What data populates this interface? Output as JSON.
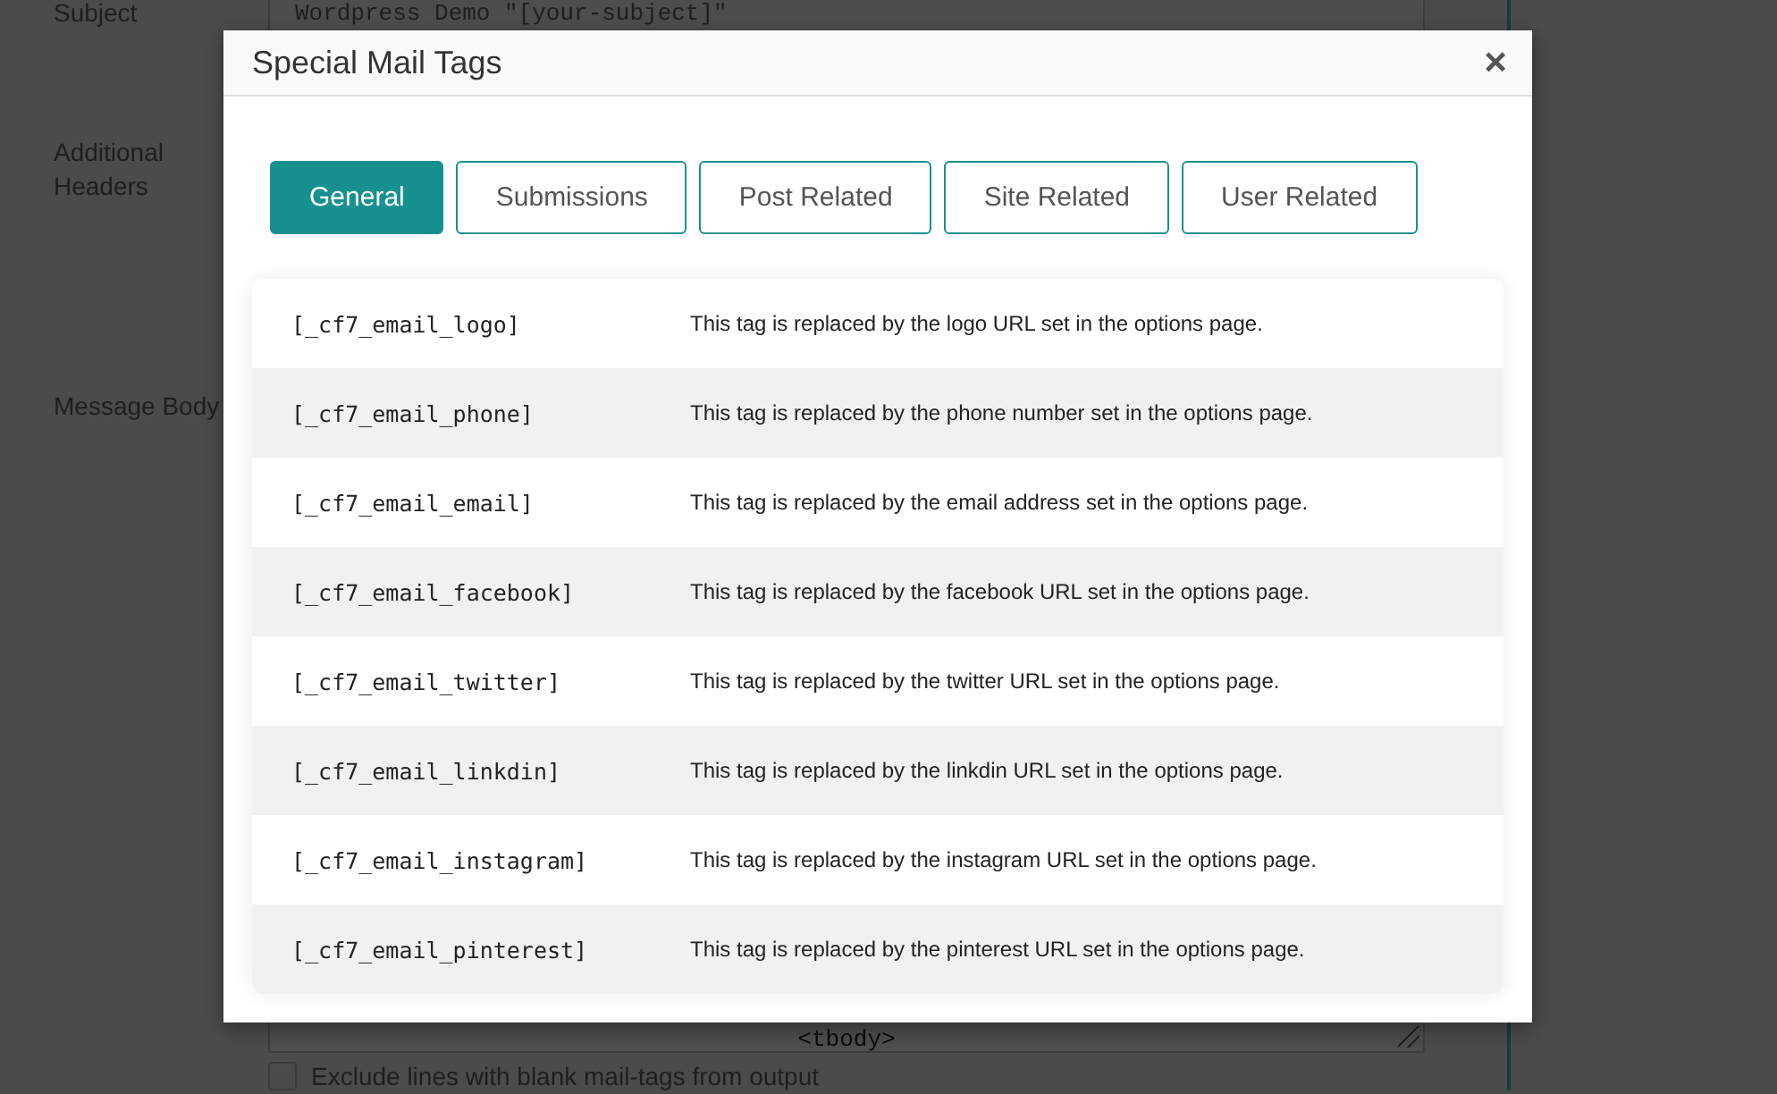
{
  "form": {
    "fields": [
      {
        "label": "Subject",
        "kind": "input",
        "value": "Wordpress Demo \"[your-subject]\""
      },
      {
        "label": "Additional Headers",
        "kind": "blank"
      },
      {
        "label": "Message Body",
        "kind": "textarea",
        "value": "<tbody>"
      }
    ],
    "checkbox": {
      "label": "Exclude lines with blank mail-tags from output",
      "checked": false
    }
  },
  "dialog": {
    "title": "Special Mail Tags",
    "close": "×",
    "tabs": [
      {
        "label": "General",
        "selected": true
      },
      {
        "label": "Submissions",
        "selected": false
      },
      {
        "label": "Post Related",
        "selected": false
      },
      {
        "label": "Site Related",
        "selected": false
      },
      {
        "label": "User Related",
        "selected": false
      }
    ],
    "rows": [
      {
        "tag": "[_cf7_email_logo]",
        "description": "This tag is replaced by the logo URL set in the options page."
      },
      {
        "tag": "[_cf7_email_phone]",
        "description": "This tag is replaced by the phone number set in the options page."
      },
      {
        "tag": "[_cf7_email_email]",
        "description": "This tag is replaced by the email address set in the options page."
      },
      {
        "tag": "[_cf7_email_facebook]",
        "description": "This tag is replaced by the facebook URL set in the options page."
      },
      {
        "tag": "[_cf7_email_twitter]",
        "description": "This tag is replaced by the twitter URL set in the options page."
      },
      {
        "tag": "[_cf7_email_linkdin]",
        "description": "This tag is replaced by the linkdin URL set in the options page."
      },
      {
        "tag": "[_cf7_email_instagram]",
        "description": "This tag is replaced by the instagram URL set in the options page."
      },
      {
        "tag": "[_cf7_email_pinterest]",
        "description": "This tag is replaced by the pinterest URL set in the options page."
      }
    ]
  }
}
